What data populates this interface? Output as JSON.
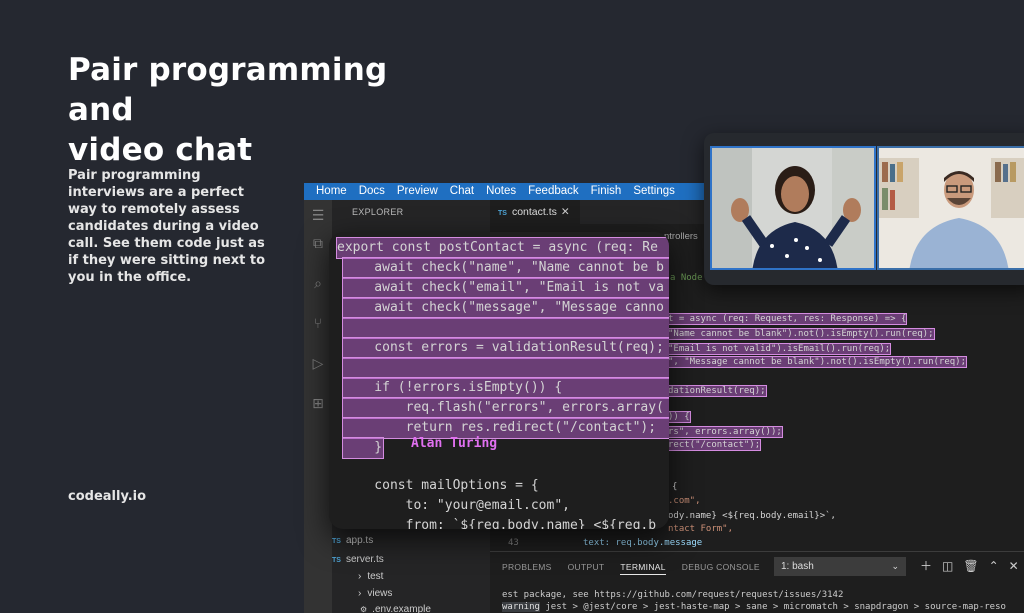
{
  "promo": {
    "headline_line1": "Pair programming and",
    "headline_line2": "video chat",
    "blurb": "Pair programming interviews are a perfect way to remotely assess candidates during a video call. See them code just as if they were sitting next to you in the office.",
    "brand": "codeally.io"
  },
  "ide": {
    "menu": [
      "Home",
      "Docs",
      "Preview",
      "Chat",
      "Notes",
      "Feedback",
      "Finish",
      "Settings"
    ],
    "explorer_title": "EXPLORER",
    "active_tab": "contact.ts",
    "breadcrumb": "ntrollers",
    "file_tree": [
      "app.ts",
      "server.ts",
      "test",
      "views",
      ".env.example"
    ],
    "line_number": "43",
    "back_code": {
      "l1": "t = async (req: Request, res: Response) => {",
      "l2": "\"Name cannot be blank\").not().isEmpty().run(req);",
      "l3": "\"Email is not valid\").isEmail().run(req);",
      "l4": "\", \"Message cannot be blank\").not().isEmpty().run(req);",
      "l5": "dationResult(req);",
      "l6": ")) {",
      "l7": "rs\", errors.array());",
      "l8": "rect(\"/contact\");",
      "l9": "{",
      "l10": ".com\",",
      "l11": "ody.name} <${req.body.email}>`,",
      "l12": "ntact Form\",",
      "l13": "text: req.body.message",
      "comment": "a Node"
    },
    "panel": {
      "tabs": [
        "PROBLEMS",
        "OUTPUT",
        "TERMINAL",
        "DEBUG CONSOLE"
      ],
      "active_tab": "TERMINAL",
      "shell": "1: bash",
      "terminal_line1": "est package, see https://github.com/request/request/issues/3142",
      "terminal_line2_prefix": "warning",
      "terminal_line2": " jest > @jest/core > jest-haste-map > sane > micromatch > snapdragon > source-map-reso"
    }
  },
  "zoom_code": {
    "lines": [
      "export const postContact = async (req: Re",
      "    await check(\"name\", \"Name cannot be b",
      "    await check(\"email\", \"Email is not va",
      "    await check(\"message\", \"Message canno",
      "",
      "    const errors = validationResult(req);",
      "",
      "    if (!errors.isEmpty()) {",
      "        req.flash(\"errors\", errors.array(",
      "        return res.redirect(\"/contact\");",
      "    }",
      "",
      "    const mailOptions = {",
      "        to: \"your@email.com\",",
      "        from: `${req.body.name} <${req.b"
    ],
    "cursor_user": "Alan Turing"
  },
  "colors": {
    "background": "#252830",
    "menubar": "#1f6fc1",
    "highlight": "#a85abe",
    "cursor_label": "#e070f0"
  }
}
